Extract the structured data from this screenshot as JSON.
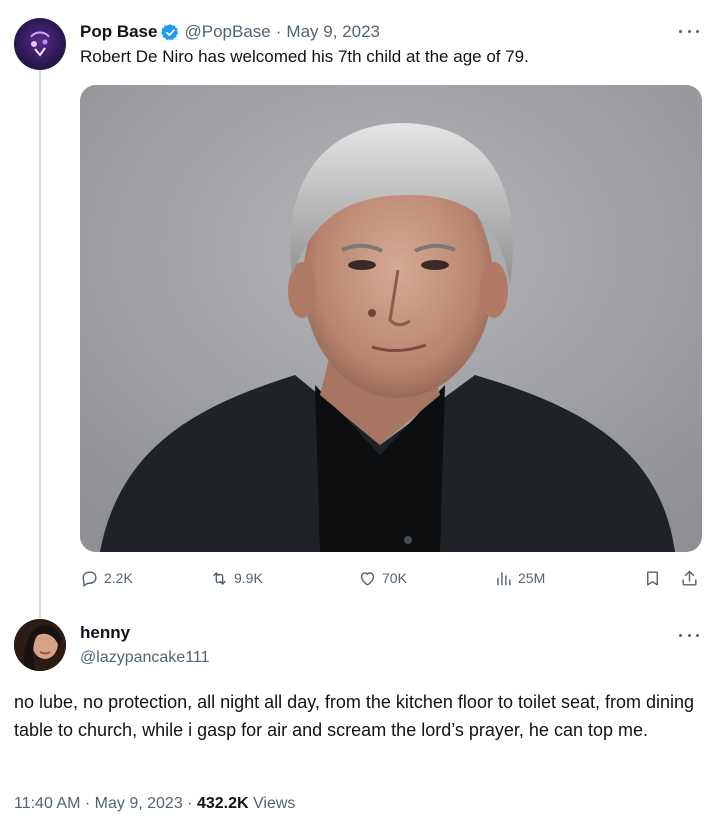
{
  "colors": {
    "accent": "#1d9bf0",
    "muted": "#536471",
    "text": "#0f1419",
    "thread_line": "#cfd9de"
  },
  "original_tweet": {
    "display_name": "Pop Base",
    "verified_icon": "verified-badge-icon",
    "handle": "@PopBase",
    "separator": "·",
    "date": "May 9, 2023",
    "text": "Robert De Niro has welcomed his 7th child at the age of 79.",
    "media_icon": "portrait-photo",
    "more_icon": "more-options-icon",
    "actions": {
      "replies": "2.2K",
      "reposts": "9.9K",
      "likes": "70K",
      "views": "25M"
    }
  },
  "reply_tweet": {
    "display_name": "henny",
    "handle": "@lazypancake111",
    "text": "no lube, no protection, all night all day, from the kitchen floor to toilet seat, from dining table to church, while i gasp for air and scream the lord’s prayer,  he can top me.",
    "time": "11:40 AM",
    "separator": "·",
    "date": "May 9, 2023",
    "separator2": "·",
    "views_count": "432.2K",
    "views_label": "Views",
    "more_icon": "more-options-icon"
  }
}
